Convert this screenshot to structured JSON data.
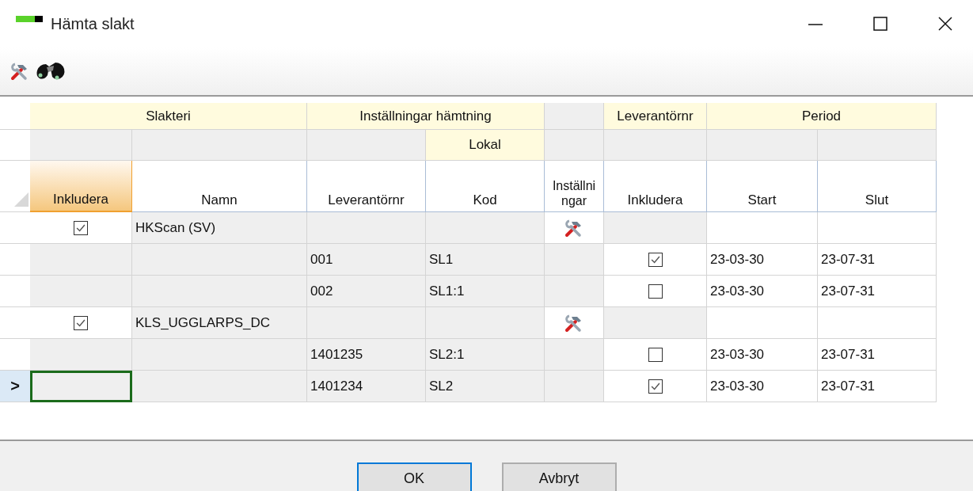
{
  "window": {
    "title": "Hämta slakt"
  },
  "grid": {
    "band_headers": {
      "slakteri": "Slakteri",
      "hamtning": "Inställningar hämtning",
      "leverantor": "Leverantörnr",
      "period": "Period"
    },
    "sub_headers": {
      "lokal": "Lokal"
    },
    "current_row_marker": ">",
    "columns": [
      {
        "label": "Inkludera",
        "selected": true
      },
      {
        "label": "Namn",
        "selected": false
      },
      {
        "label": "Leverantörnr",
        "selected": false
      },
      {
        "label": "Kod",
        "selected": false
      },
      {
        "label": "Inställningar",
        "selected": false
      },
      {
        "label": "Inkludera",
        "selected": false
      },
      {
        "label": "Start",
        "selected": false
      },
      {
        "label": "Slut",
        "selected": false
      }
    ],
    "rows": [
      {
        "kind": "group",
        "include": true,
        "name": "HKScan (SV)",
        "current": false
      },
      {
        "kind": "line",
        "supplier_no": "001",
        "code": "SL1",
        "include": true,
        "start": "23-03-30",
        "end": "23-07-31",
        "current": false
      },
      {
        "kind": "line",
        "supplier_no": "002",
        "code": "SL1:1",
        "include": false,
        "start": "23-03-30",
        "end": "23-07-31",
        "current": false
      },
      {
        "kind": "group",
        "include": true,
        "name": "KLS_UGGLARPS_DC",
        "current": false
      },
      {
        "kind": "line",
        "supplier_no": "1401235",
        "code": "SL2:1",
        "include": false,
        "start": "23-03-30",
        "end": "23-07-31",
        "current": false
      },
      {
        "kind": "line",
        "supplier_no": "1401234",
        "code": "SL2",
        "include": true,
        "start": "23-03-30",
        "end": "23-07-31",
        "current": true
      }
    ]
  },
  "buttons": [
    {
      "label": "OK",
      "default": true
    },
    {
      "label": "Avbryt",
      "default": false
    }
  ]
}
